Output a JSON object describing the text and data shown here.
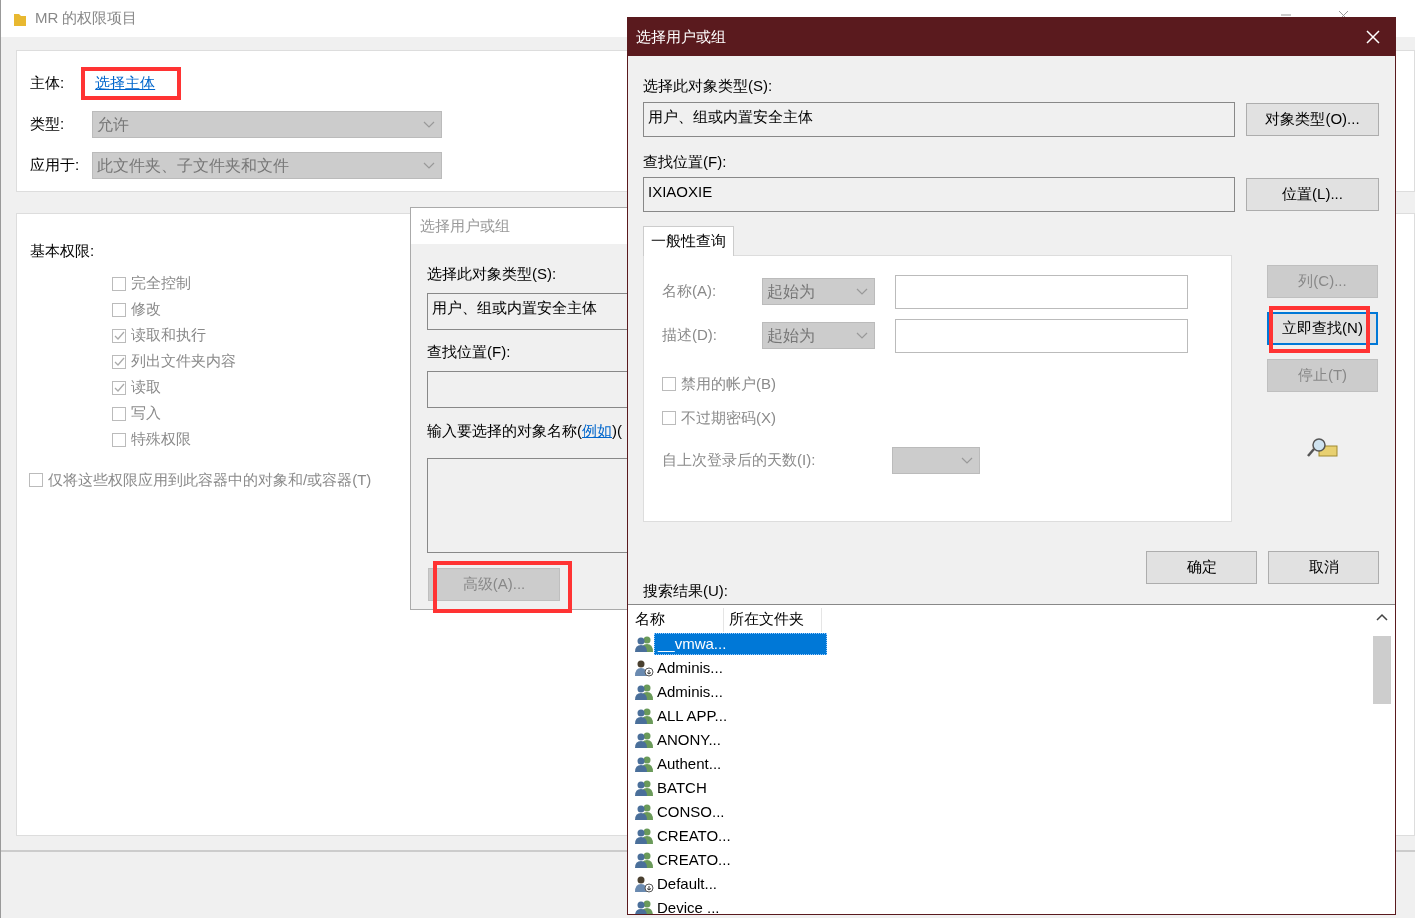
{
  "back_window": {
    "title": "MR 的权限项目",
    "principal_label": "主体:",
    "principal_link": {
      "text": "选择主体",
      "highlighted": true
    },
    "type_label": "类型:",
    "type_value": "允许",
    "applies_label": "应用于:",
    "applies_value": "此文件夹、子文件夹和文件",
    "basic_label": "基本权限:",
    "permissions": [
      {
        "label": "完全控制",
        "checked": false,
        "disabled": true
      },
      {
        "label": "修改",
        "checked": false,
        "disabled": true
      },
      {
        "label": "读取和执行",
        "checked": true,
        "disabled": true
      },
      {
        "label": "列出文件夹内容",
        "checked": true,
        "disabled": true
      },
      {
        "label": "读取",
        "checked": true,
        "disabled": true
      },
      {
        "label": "写入",
        "checked": false,
        "disabled": true
      },
      {
        "label": "特殊权限",
        "checked": false,
        "disabled": true
      }
    ],
    "apply_only": {
      "label": "仅将这些权限应用到此容器中的对象和/或容器(T)",
      "checked": false,
      "disabled": true
    }
  },
  "middle_dialog": {
    "title": "选择用户或组",
    "type_label": "选择此对象类型(S):",
    "type_value": "用户、组或内置安全主体",
    "location_label": "查找位置(F):",
    "names_label_before": "输入要选择的对象名称(",
    "names_link": "例如",
    "names_label_after": ")(",
    "advanced_button": {
      "label": "高级(A)...",
      "disabled": true,
      "highlighted": true
    }
  },
  "dialog": {
    "title": "选择用户或组",
    "type_label": "选择此对象类型(S):",
    "type_value": "用户、组或内置安全主体",
    "type_button": "对象类型(O)...",
    "location_label": "查找位置(F):",
    "location_value": "IXIAOXIE",
    "location_button": "位置(L)...",
    "tabs": [
      {
        "label": "一般性查询",
        "selected": true
      }
    ],
    "name_label": "名称(A):",
    "name_mode": "起始为",
    "desc_label": "描述(D):",
    "desc_mode": "起始为",
    "options": [
      {
        "label": "禁用的帐户(B)",
        "checked": false
      },
      {
        "label": "不过期密码(X)",
        "checked": false
      }
    ],
    "days_label": "自上次登录后的天数(I):",
    "side_buttons": [
      {
        "label": "列(C)...",
        "disabled": true,
        "default": false,
        "highlighted": false
      },
      {
        "label": "立即查找(N)",
        "disabled": false,
        "default": true,
        "highlighted": true
      },
      {
        "label": "停止(T)",
        "disabled": true,
        "default": false,
        "highlighted": false
      }
    ],
    "ok_button": "确定",
    "cancel_button": "取消",
    "results_label": "搜索结果(U):",
    "columns": [
      "名称",
      "所在文件夹"
    ],
    "results": [
      {
        "name": "__vmwa...",
        "kind": "group",
        "selected": true
      },
      {
        "name": "Adminis...",
        "kind": "user",
        "selected": false
      },
      {
        "name": "Adminis...",
        "kind": "group",
        "selected": false
      },
      {
        "name": "ALL APP...",
        "kind": "group",
        "selected": false
      },
      {
        "name": "ANONY...",
        "kind": "group",
        "selected": false
      },
      {
        "name": "Authent...",
        "kind": "group",
        "selected": false
      },
      {
        "name": "BATCH",
        "kind": "group",
        "selected": false
      },
      {
        "name": "CONSO...",
        "kind": "group",
        "selected": false
      },
      {
        "name": "CREATO...",
        "kind": "group",
        "selected": false
      },
      {
        "name": "CREATO...",
        "kind": "group",
        "selected": false
      },
      {
        "name": "Default...",
        "kind": "user",
        "selected": false
      },
      {
        "name": "Device ...",
        "kind": "group",
        "selected": false
      }
    ]
  }
}
